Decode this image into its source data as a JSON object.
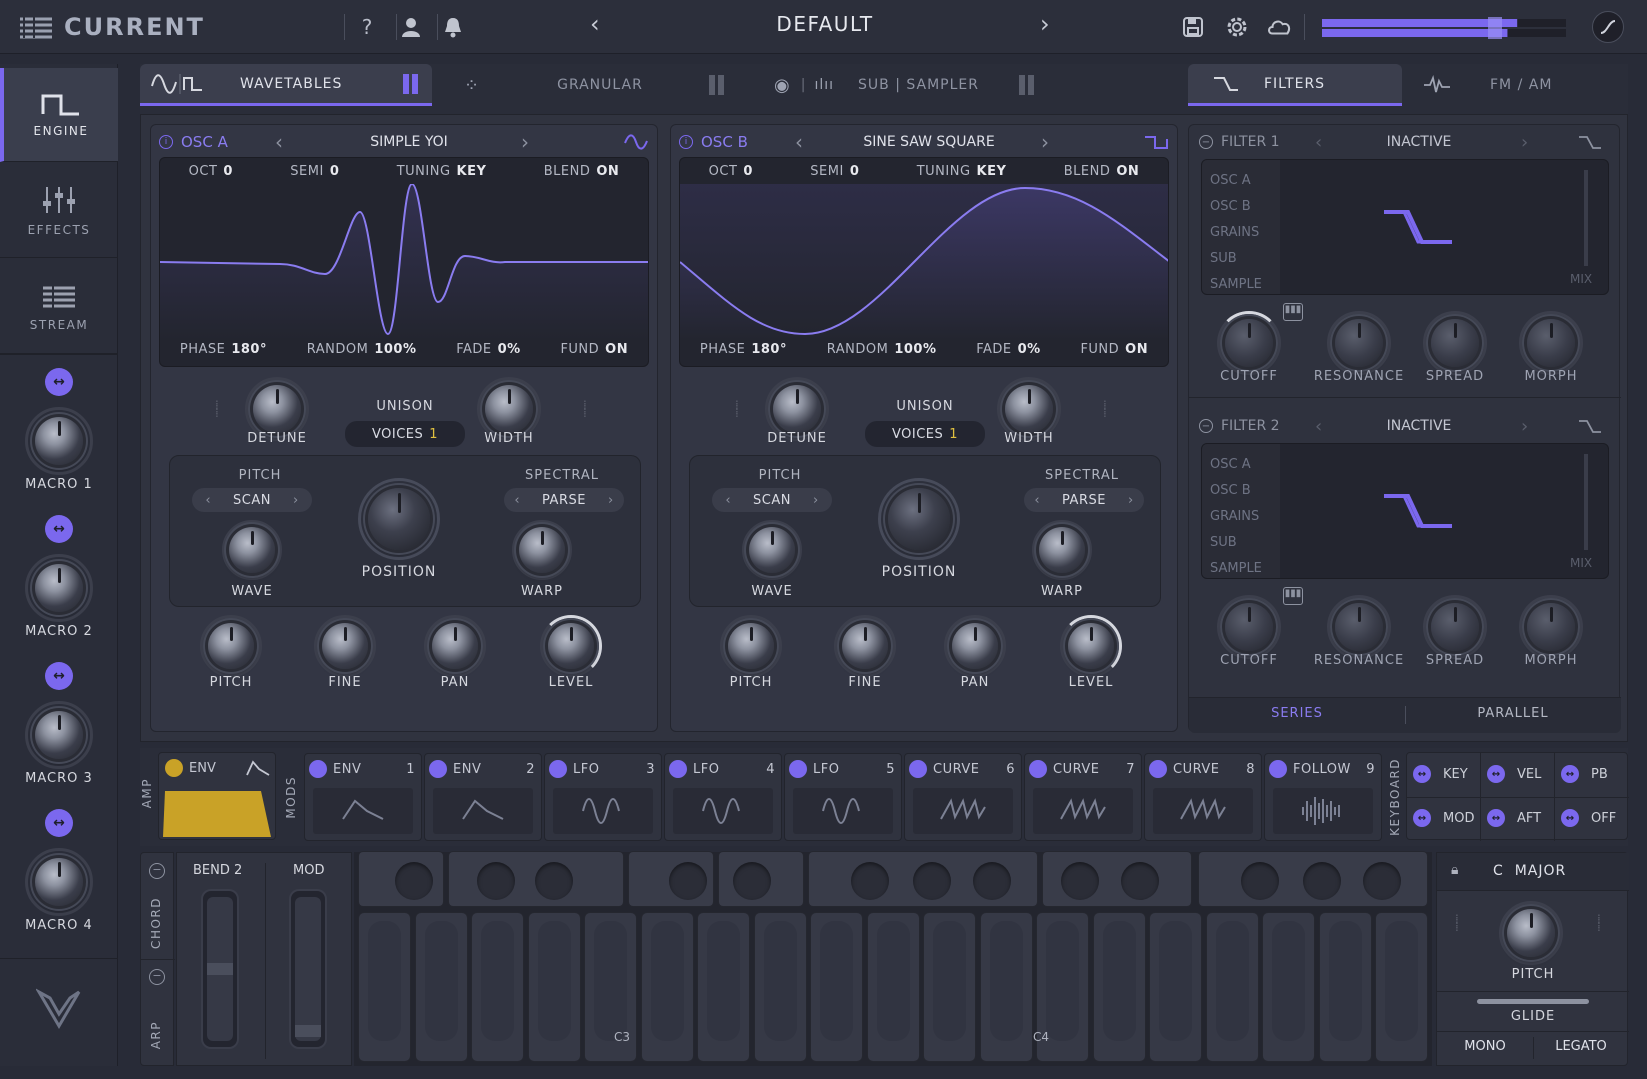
{
  "topbar": {
    "brand": "CURRENT",
    "preset": "DEFAULT",
    "help_icon": "question-icon",
    "user_icon": "user-icon",
    "bell_icon": "bell-icon",
    "save_icon": "save-icon",
    "settings_icon": "gear-icon",
    "cloud_icon": "cloud-icon",
    "level_meter": 0.8
  },
  "sidebar": {
    "tabs": [
      {
        "label": "ENGINE",
        "icon": "wave-square-icon",
        "active": true
      },
      {
        "label": "EFFECTS",
        "icon": "sliders-icon",
        "active": false
      },
      {
        "label": "STREAM",
        "icon": "stream-icon",
        "active": false
      }
    ],
    "macros": [
      "MACRO 1",
      "MACRO 2",
      "MACRO 3",
      "MACRO 4"
    ]
  },
  "engine_tabs": [
    {
      "label": "WAVETABLES",
      "active": true
    },
    {
      "label": "GRANULAR",
      "active": false
    },
    {
      "label": "SUB | SAMPLER",
      "active": false
    }
  ],
  "filter_tabs": [
    {
      "label": "FILTERS",
      "active": true
    },
    {
      "label": "FM / AM",
      "active": false
    }
  ],
  "osc_a": {
    "name": "OSC A",
    "wavetable": "SIMPLE YOI",
    "top_params": [
      {
        "label": "OCT",
        "value": "0"
      },
      {
        "label": "SEMI",
        "value": "0"
      },
      {
        "label": "TUNING",
        "value": "KEY"
      },
      {
        "label": "BLEND",
        "value": "ON"
      }
    ],
    "bottom_params": [
      {
        "label": "PHASE",
        "value": "180°"
      },
      {
        "label": "RANDOM",
        "value": "100%"
      },
      {
        "label": "FADE",
        "value": "0%"
      },
      {
        "label": "FUND",
        "value": "ON"
      }
    ],
    "unison_label": "UNISON",
    "voices_label": "VOICES",
    "voices_value": "1",
    "detune": "DETUNE",
    "width": "WIDTH",
    "pitch_label": "PITCH",
    "pitch_mode": "SCAN",
    "spectral_label": "SPECTRAL",
    "spectral_mode": "PARSE",
    "wave": "WAVE",
    "position": "POSITION",
    "warp": "WARP",
    "knobs": [
      "PITCH",
      "FINE",
      "PAN",
      "LEVEL"
    ]
  },
  "osc_b": {
    "name": "OSC B",
    "wavetable": "SINE SAW SQUARE",
    "top_params": [
      {
        "label": "OCT",
        "value": "0"
      },
      {
        "label": "SEMI",
        "value": "0"
      },
      {
        "label": "TUNING",
        "value": "KEY"
      },
      {
        "label": "BLEND",
        "value": "ON"
      }
    ],
    "bottom_params": [
      {
        "label": "PHASE",
        "value": "180°"
      },
      {
        "label": "RANDOM",
        "value": "100%"
      },
      {
        "label": "FADE",
        "value": "0%"
      },
      {
        "label": "FUND",
        "value": "ON"
      }
    ],
    "unison_label": "UNISON",
    "voices_label": "VOICES",
    "voices_value": "1",
    "detune": "DETUNE",
    "width": "WIDTH",
    "pitch_label": "PITCH",
    "pitch_mode": "SCAN",
    "spectral_label": "SPECTRAL",
    "spectral_mode": "PARSE",
    "wave": "WAVE",
    "position": "POSITION",
    "warp": "WARP",
    "knobs": [
      "PITCH",
      "FINE",
      "PAN",
      "LEVEL"
    ]
  },
  "filters": [
    {
      "name": "FILTER 1",
      "type": "INACTIVE",
      "sources": [
        "OSC A",
        "OSC B",
        "GRAINS",
        "SUB",
        "SAMPLE"
      ],
      "mix": "MIX",
      "knobs": [
        "CUTOFF",
        "RESONANCE",
        "SPREAD",
        "MORPH"
      ]
    },
    {
      "name": "FILTER 2",
      "type": "INACTIVE",
      "sources": [
        "OSC A",
        "OSC B",
        "GRAINS",
        "SUB",
        "SAMPLE"
      ],
      "mix": "MIX",
      "knobs": [
        "CUTOFF",
        "RESONANCE",
        "SPREAD",
        "MORPH"
      ]
    }
  ],
  "routing": {
    "series": "SERIES",
    "parallel": "PARALLEL"
  },
  "mod_section": {
    "amp_label": "AMP",
    "mods_label": "MODS",
    "amp_env": "ENV",
    "mods": [
      {
        "label": "ENV",
        "num": "1",
        "shape": "env"
      },
      {
        "label": "ENV",
        "num": "2",
        "shape": "env"
      },
      {
        "label": "LFO",
        "num": "3",
        "shape": "lfo"
      },
      {
        "label": "LFO",
        "num": "4",
        "shape": "lfo"
      },
      {
        "label": "LFO",
        "num": "5",
        "shape": "lfo"
      },
      {
        "label": "CURVE",
        "num": "6",
        "shape": "curve"
      },
      {
        "label": "CURVE",
        "num": "7",
        "shape": "curve"
      },
      {
        "label": "CURVE",
        "num": "8",
        "shape": "curve"
      },
      {
        "label": "FOLLOW",
        "num": "9",
        "shape": "follow"
      }
    ],
    "keyboard_label": "KEYBOARD",
    "keyboard_sources": [
      "KEY",
      "VEL",
      "PB",
      "MOD",
      "AFT",
      "OFF"
    ]
  },
  "keyboard": {
    "chord_label": "CHORD",
    "arp_label": "ARP",
    "bend_label": "BEND",
    "bend_value": "2",
    "mod_label": "MOD",
    "c3": "C3",
    "c4": "C4",
    "scale_key": "C",
    "scale_mode": "MAJOR",
    "pitch": "PITCH",
    "glide": "GLIDE",
    "mono": "MONO",
    "legato": "LEGATO"
  },
  "colors": {
    "accent": "#7b68ee",
    "amp_env": "#c9a227",
    "background": "#282b37"
  }
}
